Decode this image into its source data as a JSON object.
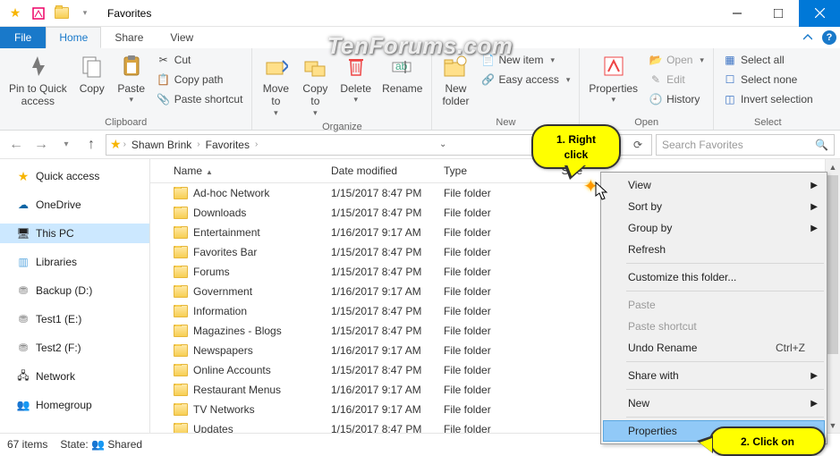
{
  "window": {
    "title": "Favorites"
  },
  "tabs": {
    "file": "File",
    "home": "Home",
    "share": "Share",
    "view": "View"
  },
  "ribbon": {
    "clipboard": {
      "label": "Clipboard",
      "pin": "Pin to Quick\naccess",
      "copy": "Copy",
      "paste": "Paste",
      "cut": "Cut",
      "copypath": "Copy path",
      "pasteshortcut": "Paste shortcut"
    },
    "organize": {
      "label": "Organize",
      "moveto": "Move\nto",
      "copyto": "Copy\nto",
      "delete": "Delete",
      "rename": "Rename"
    },
    "new": {
      "label": "New",
      "newfolder": "New\nfolder",
      "newitem": "New item",
      "easyaccess": "Easy access"
    },
    "open": {
      "label": "Open",
      "properties": "Properties",
      "open": "Open",
      "edit": "Edit",
      "history": "History"
    },
    "select": {
      "label": "Select",
      "selectall": "Select all",
      "selectnone": "Select none",
      "invert": "Invert selection"
    }
  },
  "breadcrumb": {
    "seg1": "Shawn Brink",
    "seg2": "Favorites"
  },
  "search": {
    "placeholder": "Search Favorites"
  },
  "sidebar": {
    "quick": "Quick access",
    "onedrive": "OneDrive",
    "thispc": "This PC",
    "libraries": "Libraries",
    "backup": "Backup (D:)",
    "test1": "Test1 (E:)",
    "test2": "Test2 (F:)",
    "network": "Network",
    "homegroup": "Homegroup"
  },
  "columns": {
    "name": "Name",
    "date": "Date modified",
    "type": "Type",
    "size": "Size"
  },
  "rows": [
    {
      "name": "Ad-hoc Network",
      "date": "1/15/2017 8:47 PM",
      "type": "File folder"
    },
    {
      "name": "Downloads",
      "date": "1/15/2017 8:47 PM",
      "type": "File folder"
    },
    {
      "name": "Entertainment",
      "date": "1/16/2017 9:17 AM",
      "type": "File folder"
    },
    {
      "name": "Favorites Bar",
      "date": "1/15/2017 8:47 PM",
      "type": "File folder"
    },
    {
      "name": "Forums",
      "date": "1/15/2017 8:47 PM",
      "type": "File folder"
    },
    {
      "name": "Government",
      "date": "1/16/2017 9:17 AM",
      "type": "File folder"
    },
    {
      "name": "Information",
      "date": "1/15/2017 8:47 PM",
      "type": "File folder"
    },
    {
      "name": "Magazines - Blogs",
      "date": "1/15/2017 8:47 PM",
      "type": "File folder"
    },
    {
      "name": "Newspapers",
      "date": "1/16/2017 9:17 AM",
      "type": "File folder"
    },
    {
      "name": "Online Accounts",
      "date": "1/15/2017 8:47 PM",
      "type": "File folder"
    },
    {
      "name": "Restaurant Menus",
      "date": "1/16/2017 9:17 AM",
      "type": "File folder"
    },
    {
      "name": "TV Networks",
      "date": "1/16/2017 9:17 AM",
      "type": "File folder"
    },
    {
      "name": "Updates",
      "date": "1/15/2017 8:47 PM",
      "type": "File folder"
    }
  ],
  "context": {
    "view": "View",
    "sort": "Sort by",
    "group": "Group by",
    "refresh": "Refresh",
    "customize": "Customize this folder...",
    "paste": "Paste",
    "pasteshortcut": "Paste shortcut",
    "undo": "Undo Rename",
    "undo_key": "Ctrl+Z",
    "sharewith": "Share with",
    "new": "New",
    "properties": "Properties"
  },
  "status": {
    "items": "67 items",
    "state_label": "State:",
    "state_value": "Shared"
  },
  "callouts": {
    "c1a": "1. Right",
    "c1b": "click",
    "c2": "2. Click on"
  },
  "watermark": "TenForums.com"
}
